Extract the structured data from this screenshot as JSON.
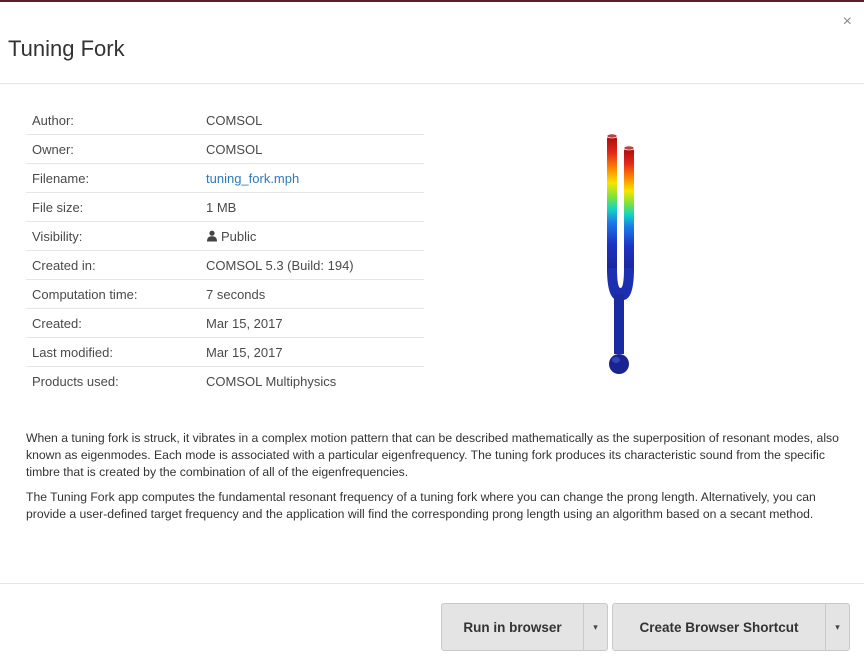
{
  "dialog": {
    "title": "Tuning Fork",
    "close_glyph": "×"
  },
  "details": [
    {
      "label": "Author:",
      "value": "COMSOL"
    },
    {
      "label": "Owner:",
      "value": "COMSOL"
    },
    {
      "label": "Filename:",
      "value": "tuning_fork.mph",
      "link": true
    },
    {
      "label": "File size:",
      "value": "1 MB"
    },
    {
      "label": "Visibility:",
      "value": "Public",
      "icon": "person-icon"
    },
    {
      "label": "Created in:",
      "value": "COMSOL 5.3 (Build: 194)"
    },
    {
      "label": "Computation time:",
      "value": "7 seconds"
    },
    {
      "label": "Created:",
      "value": "Mar 15, 2017"
    },
    {
      "label": "Last modified:",
      "value": "Mar 15, 2017"
    },
    {
      "label": "Products used:",
      "value": "COMSOL Multiphysics"
    }
  ],
  "description": [
    "When a tuning fork is struck, it vibrates in a complex motion pattern that can be described mathematically as the superposition of resonant modes, also known as eigenmodes. Each mode is associated with a particular eigenfrequency. The tuning fork produces its characteristic sound from the specific timbre that is created by the combination of all of the eigenfrequencies.",
    "The Tuning Fork app computes the fundamental resonant frequency of a tuning fork where you can change the prong length. Alternatively, you can provide a user-defined target frequency and the application will find the corresponding prong length using an algorithm based on a secant method."
  ],
  "actions": {
    "run_label": "Run in browser",
    "shortcut_label": "Create Browser Shortcut",
    "caret_glyph": "▾"
  },
  "colors": {
    "link": "#2f7abf",
    "button_bg": "#e4e4e4",
    "header_border": "#5a1f2b"
  }
}
